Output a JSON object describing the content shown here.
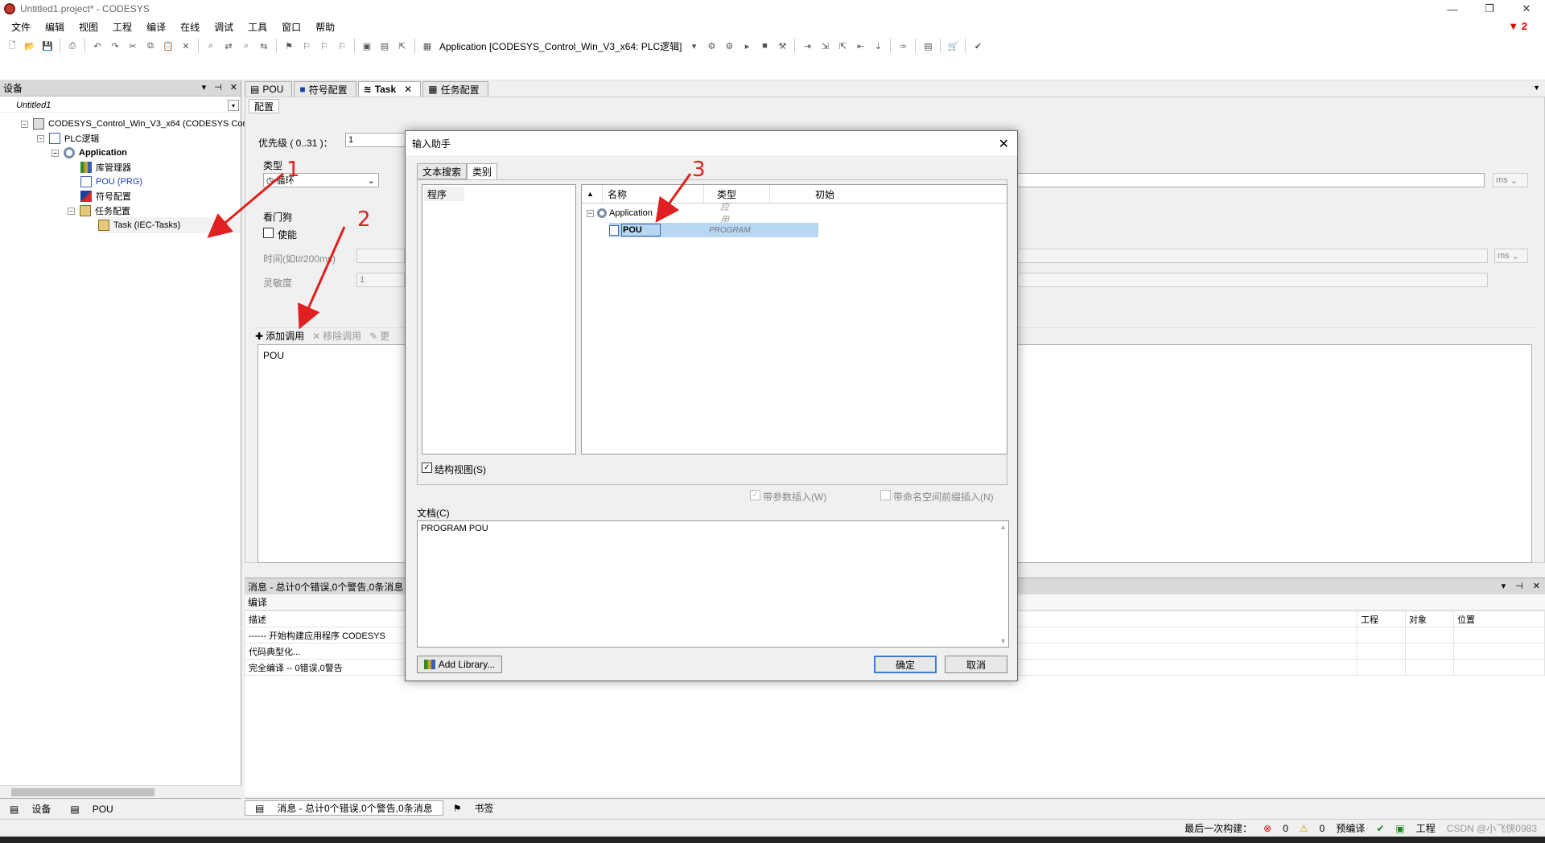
{
  "window": {
    "title": "Untitled1.project* - CODESYS",
    "error_count": "2"
  },
  "menu": [
    "文件",
    "编辑",
    "视图",
    "工程",
    "编译",
    "在线",
    "调试",
    "工具",
    "窗口",
    "帮助"
  ],
  "toolbar": {
    "active_application": "Application [CODESYS_Control_Win_V3_x64: PLC逻辑]"
  },
  "devices": {
    "title": "设备",
    "project": "Untitled1",
    "tree": [
      {
        "label": "CODESYS_Control_Win_V3_x64 (CODESYS Contr"
      },
      {
        "label": "PLC逻辑"
      },
      {
        "label": "Application"
      },
      {
        "label": "库管理器"
      },
      {
        "label": "POU (PRG)"
      },
      {
        "label": "符号配置"
      },
      {
        "label": "任务配置"
      },
      {
        "label": "Task (IEC-Tasks)"
      }
    ],
    "bottom_tabs": [
      "设备",
      "POU"
    ]
  },
  "editor_tabs": [
    "POU",
    "符号配置",
    "Task",
    "任务配置"
  ],
  "config": {
    "tab": "配置",
    "priority_label": "优先级 ( 0..31 )：",
    "priority_value": "1",
    "type_label": "类型",
    "type_value": "循环",
    "type_unit": "ms",
    "watchdog_label": "看门狗",
    "enable_label": "使能",
    "time_label": "时间(如t#200ms)",
    "time_unit": "ms",
    "sensitivity_label": "灵敏度",
    "sensitivity_value": "1",
    "add_call": "添加调用",
    "remove_call": "移除调用",
    "change_call": "更",
    "calls": [
      "POU"
    ]
  },
  "messages": {
    "title": "消息 - 总计0个错误,0个警告,0条消息",
    "category": "编译",
    "columns": [
      "描述",
      "工程",
      "对象",
      "位置"
    ],
    "rows": [
      "------ 开始构建应用程序 CODESYS",
      "代码典型化...",
      "完全编译 -- 0错误,0警告"
    ],
    "tabs": [
      "消息 - 总计0个错误,0个警告,0条消息",
      "书签"
    ]
  },
  "status": {
    "last_build": "最后一次构建：",
    "errors": "0",
    "warnings": "0",
    "precompile": "预编译",
    "project_user": "工程",
    "watermark": "CSDN @小飞侠0983"
  },
  "dialog": {
    "title": "输入助手",
    "tabs": [
      "文本搜索",
      "类别"
    ],
    "categories": [
      "程序"
    ],
    "columns": [
      "名称",
      "类型",
      "初始"
    ],
    "rows": [
      {
        "name": "Application",
        "type": "应用"
      },
      {
        "name": "POU",
        "type": "PROGRAM"
      }
    ],
    "structured_view": "结构视图(S)",
    "insert_with_args": "带参数插入(W)",
    "insert_with_namespace": "带命名空间前缀插入(N)",
    "doc_label": "文档(C)",
    "doc_text": "PROGRAM POU",
    "add_library": "Add Library...",
    "ok": "确定",
    "cancel": "取消"
  },
  "annotations": [
    "1",
    "2",
    "3"
  ]
}
